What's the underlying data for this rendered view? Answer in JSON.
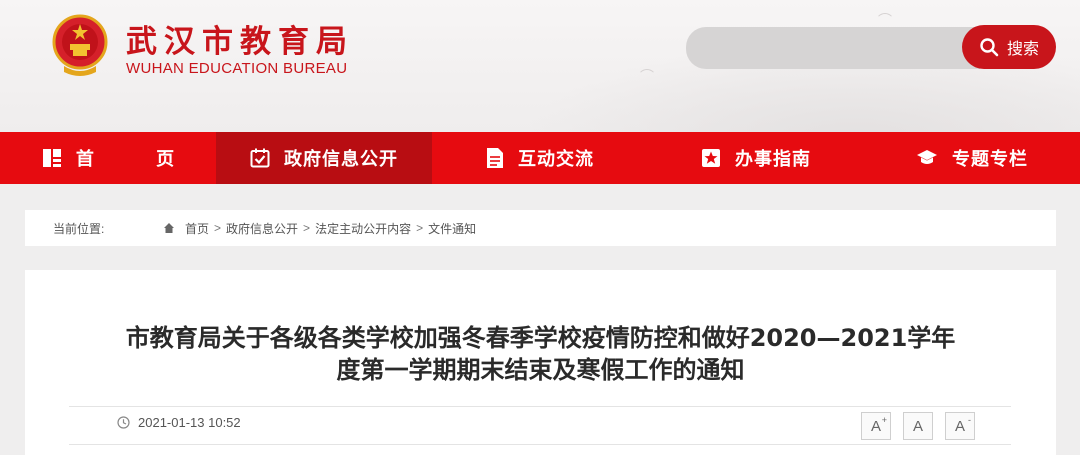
{
  "header": {
    "title_cn": "武汉市教育局",
    "title_en": "WUHAN EDUCATION BUREAU",
    "search": {
      "placeholder": "",
      "button_label": "搜索"
    }
  },
  "nav": {
    "items": [
      {
        "label": "首 页",
        "icon": "grid-icon",
        "active": false
      },
      {
        "label": "政府信息公开",
        "icon": "calendar-check-icon",
        "active": true
      },
      {
        "label": "互动交流",
        "icon": "document-icon",
        "active": false
      },
      {
        "label": "办事指南",
        "icon": "star-badge-icon",
        "active": false
      },
      {
        "label": "专题专栏",
        "icon": "graduation-cap-icon",
        "active": false
      }
    ]
  },
  "breadcrumb": {
    "label": "当前位置:",
    "items": [
      "首页",
      "政府信息公开",
      "法定主动公开内容",
      "文件通知"
    ],
    "separator": ">"
  },
  "article": {
    "title_line1": "市教育局关于各级各类学校加强冬春季学校疫情防控和做好2020—2021学年",
    "title_line2": "度第一学期期末结束及寒假工作的通知",
    "date": "2021-01-13 10:52",
    "font_buttons": [
      "A",
      "A",
      "A"
    ],
    "font_button_marks": [
      "+",
      "",
      "-"
    ]
  },
  "colors": {
    "brand_red": "#e60b10",
    "active_red": "#b80d12",
    "title_red": "#c8151b"
  }
}
